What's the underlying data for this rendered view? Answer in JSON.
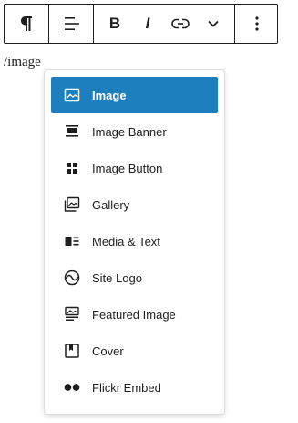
{
  "toolbar": {
    "paragraph_icon": "paragraph-icon",
    "align_icon": "align-left-icon",
    "bold_label": "B",
    "italic_label": "I",
    "link_icon": "link-icon",
    "more_rich_icon": "chevron-down-icon",
    "options_icon": "more-vertical-icon"
  },
  "editor": {
    "typed_text": "/image"
  },
  "autocomplete": {
    "accent_color": "#1e7fbf",
    "items": [
      {
        "label": "Image",
        "icon": "image-icon",
        "selected": true
      },
      {
        "label": "Image Banner",
        "icon": "image-banner-icon",
        "selected": false
      },
      {
        "label": "Image Button",
        "icon": "grid-icon",
        "selected": false
      },
      {
        "label": "Gallery",
        "icon": "gallery-icon",
        "selected": false
      },
      {
        "label": "Media & Text",
        "icon": "media-text-icon",
        "selected": false
      },
      {
        "label": "Site Logo",
        "icon": "site-logo-icon",
        "selected": false
      },
      {
        "label": "Featured Image",
        "icon": "featured-image-icon",
        "selected": false
      },
      {
        "label": "Cover",
        "icon": "cover-icon",
        "selected": false
      },
      {
        "label": "Flickr Embed",
        "icon": "flickr-icon",
        "selected": false
      }
    ]
  }
}
